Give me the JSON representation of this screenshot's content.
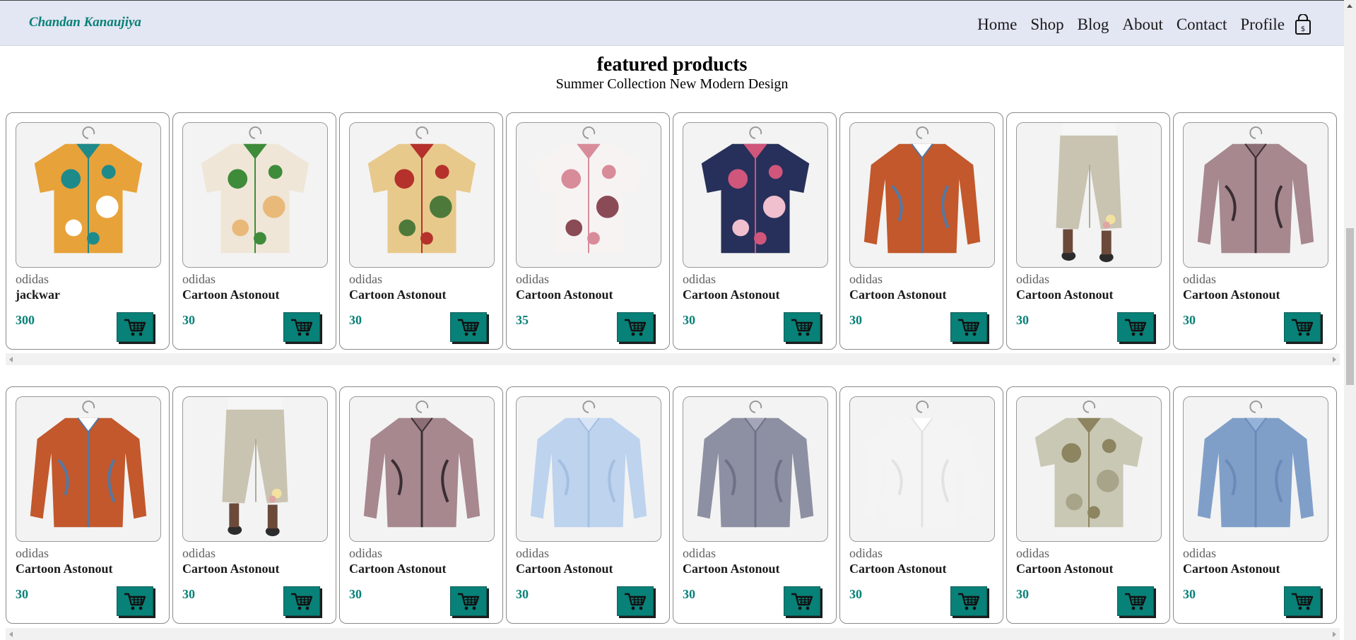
{
  "header": {
    "logo": "Chandan Kanaujiya",
    "nav": [
      "Home",
      "Shop",
      "Blog",
      "About",
      "Contact",
      "Profile"
    ],
    "bag_icon": "shopping-bag-icon"
  },
  "section": {
    "title": "featured products",
    "subtitle": "Summer Collection New Modern Design"
  },
  "colors": {
    "accent": "#088178",
    "header_bg": "#e3e6f3"
  },
  "rows": [
    {
      "products": [
        {
          "brand": "odidas",
          "name": "jackwar",
          "price": "300",
          "image": "abstract-print-shirt"
        },
        {
          "brand": "odidas",
          "name": "Cartoon Astonout",
          "price": "30",
          "image": "green-leaf-shirt"
        },
        {
          "brand": "odidas",
          "name": "Cartoon Astonout",
          "price": "30",
          "image": "floral-yellow-shirt"
        },
        {
          "brand": "odidas",
          "name": "Cartoon Astonout",
          "price": "35",
          "image": "white-pink-floral-shirt"
        },
        {
          "brand": "odidas",
          "name": "Cartoon Astonout",
          "price": "30",
          "image": "navy-floral-shirt"
        },
        {
          "brand": "odidas",
          "name": "Cartoon Astonout",
          "price": "30",
          "image": "orange-blue-shirt"
        },
        {
          "brand": "odidas",
          "name": "Cartoon Astonout",
          "price": "30",
          "image": "beige-trousers"
        },
        {
          "brand": "odidas",
          "name": "Cartoon Astonout",
          "price": "30",
          "image": "mauve-print-top"
        }
      ]
    },
    {
      "products": [
        {
          "brand": "odidas",
          "name": "Cartoon Astonout",
          "price": "30",
          "image": "orange-blue-shirt"
        },
        {
          "brand": "odidas",
          "name": "Cartoon Astonout",
          "price": "30",
          "image": "beige-trousers"
        },
        {
          "brand": "odidas",
          "name": "Cartoon Astonout",
          "price": "30",
          "image": "mauve-print-top"
        },
        {
          "brand": "odidas",
          "name": "Cartoon Astonout",
          "price": "30",
          "image": "light-blue-shirt"
        },
        {
          "brand": "odidas",
          "name": "Cartoon Astonout",
          "price": "30",
          "image": "grey-check-shirt"
        },
        {
          "brand": "odidas",
          "name": "Cartoon Astonout",
          "price": "30",
          "image": "white-shirt"
        },
        {
          "brand": "odidas",
          "name": "Cartoon Astonout",
          "price": "30",
          "image": "camo-short-sleeve-shirt"
        },
        {
          "brand": "odidas",
          "name": "Cartoon Astonout",
          "price": "30",
          "image": "denim-shirt"
        }
      ]
    }
  ]
}
